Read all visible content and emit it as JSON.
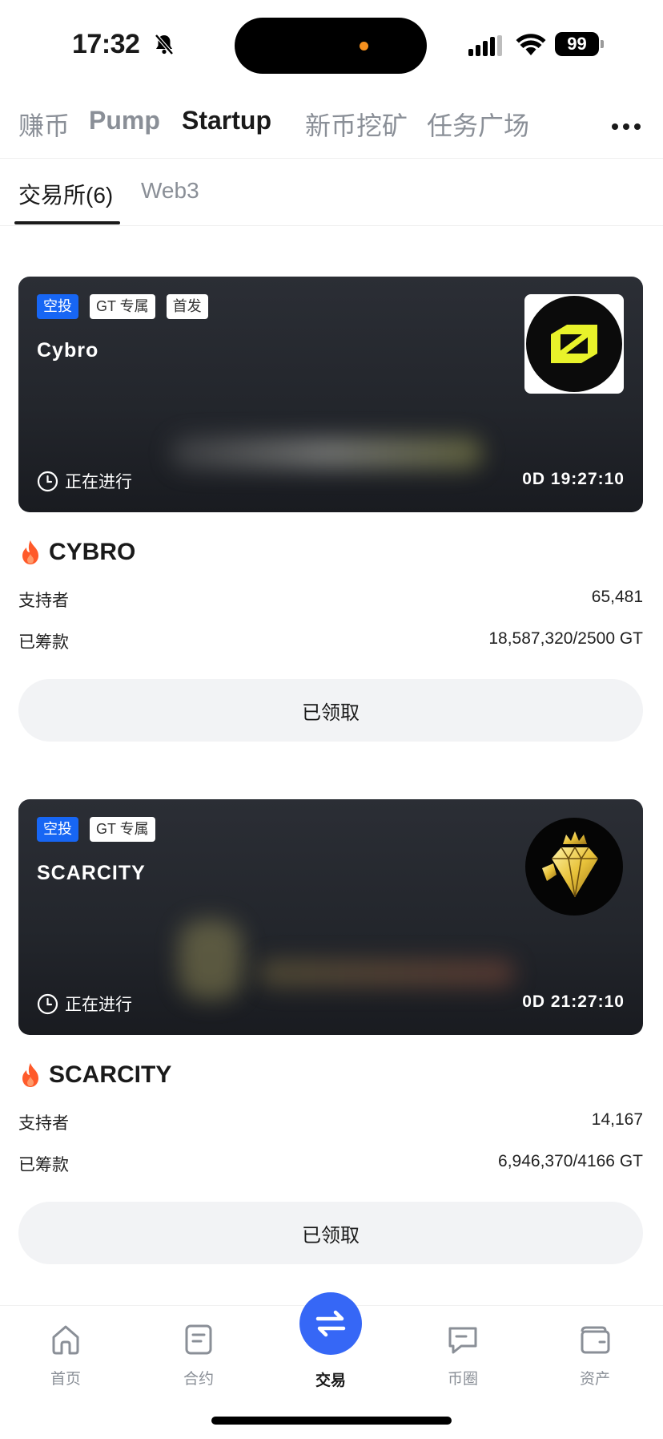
{
  "status_bar": {
    "time": "17:32",
    "battery": "99"
  },
  "top_nav": {
    "tabs": [
      {
        "label": "赚币",
        "active": false
      },
      {
        "label": "Pump",
        "active": false
      },
      {
        "label": "Startup",
        "active": true
      },
      {
        "label": "新币挖矿",
        "active": false
      },
      {
        "label": "任务广场",
        "active": false
      }
    ]
  },
  "sub_nav": {
    "tabs": [
      {
        "label": "交易所(6)",
        "active": true
      },
      {
        "label": "Web3",
        "active": false
      }
    ]
  },
  "projects": [
    {
      "tags": [
        "空投",
        "GT 专属",
        "首发"
      ],
      "banner_title": "Cybro",
      "status": "正在进行",
      "countdown": "0D 19:27:10",
      "name": "CYBRO",
      "supporters_label": "支持者",
      "supporters": "65,481",
      "raised_label": "已筹款",
      "raised": "18,587,320/2500 GT",
      "button": "已领取",
      "logo": "cybro-logo-icon"
    },
    {
      "tags": [
        "空投",
        "GT 专属"
      ],
      "banner_title": "SCARCITY",
      "status": "正在进行",
      "countdown": "0D 21:27:10",
      "name": "SCARCITY",
      "supporters_label": "支持者",
      "supporters": "14,167",
      "raised_label": "已筹款",
      "raised": "6,946,370/4166 GT",
      "button": "已领取",
      "logo": "crown-diamond-logo-icon"
    }
  ],
  "bottom_nav": {
    "items": [
      {
        "label": "首页",
        "icon": "home-icon"
      },
      {
        "label": "合约",
        "icon": "contract-icon"
      },
      {
        "label": "交易",
        "icon": "swap-icon",
        "active": true
      },
      {
        "label": "币圈",
        "icon": "chat-bubble-icon"
      },
      {
        "label": "资产",
        "icon": "wallet-icon"
      }
    ]
  },
  "colors": {
    "accent": "#3667f6",
    "tag_blue": "#1766f4",
    "fire": "#ff5a2a",
    "cybro_yellow": "#e8f22a"
  }
}
